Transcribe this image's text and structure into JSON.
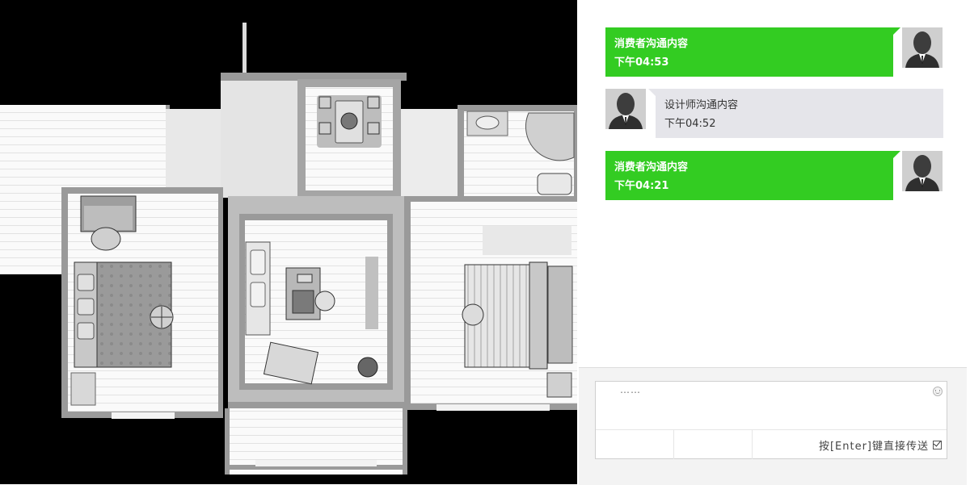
{
  "floorplan": {
    "label": "floor-plan-image"
  },
  "messages": [
    {
      "sender": "consumer",
      "text": "消费者沟通内容",
      "time": "下午04:53"
    },
    {
      "sender": "designer",
      "text": "设计师沟通内容",
      "time": "下午04:52"
    },
    {
      "sender": "consumer",
      "text": "消费者沟通内容",
      "time": "下午04:21"
    }
  ],
  "composer": {
    "placeholder": "……",
    "send_option_label": "按[Enter]键直接传送",
    "send_on_enter_checked": true
  },
  "colors": {
    "consumer_bubble": "#33cc22",
    "designer_bubble": "#e5e5ea",
    "avatar_bg": "#cfcfcf"
  }
}
